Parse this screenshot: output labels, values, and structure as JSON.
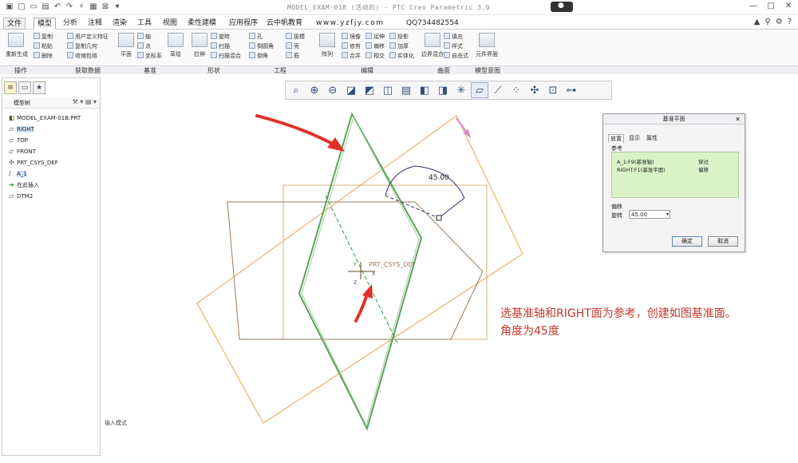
{
  "window": {
    "title": "MODEL_EXAM-01B (活动的) - PTC Creo Parametric 3.0"
  },
  "ribbon": {
    "tabs": [
      "文件",
      "模型",
      "分析",
      "注释",
      "渲染",
      "工具",
      "视图",
      "柔性建模",
      "应用程序",
      "云中帆教育",
      "www.yzfjy.com",
      "QQ734482554"
    ],
    "groups": {
      "operations": "操作",
      "get_data": "获取数据",
      "datum": "基准",
      "shapes": "形状",
      "engineering": "工程",
      "edit": "编辑",
      "surfaces": "曲面",
      "model_intent": "模型意图"
    },
    "items": {
      "regenerate": "重新生成",
      "copy": "复制",
      "paste": "粘贴",
      "delete": "删除",
      "user_defined_feature": "用户定义特征",
      "copy_geometry": "复制几何",
      "shrinkwrap": "收缩包络",
      "plane": "平面",
      "axis": "轴",
      "point": "点",
      "coord_sys": "坐标系",
      "sketch": "草绘",
      "extrude": "拉伸",
      "revolve": "旋转",
      "sweep": "扫描",
      "swept_blend": "扫描混合",
      "hole": "孔",
      "round": "倒圆角",
      "chamfer": "倒角",
      "draft": "拔模",
      "shell": "壳",
      "rib": "筋",
      "pattern": "阵列",
      "mirror": "镜像",
      "trim": "修剪",
      "merge": "合并",
      "extend": "延伸",
      "offset": "偏移",
      "intersect": "相交",
      "project": "投影",
      "thicken": "加厚",
      "solidify": "实体化",
      "boundary_blend": "边界混合",
      "fill": "填充",
      "style": "样式",
      "freestyle": "自由式",
      "component_interface": "元件界面"
    }
  },
  "model_tree": {
    "header": "模型树",
    "items": [
      {
        "label": "MODEL_EXAM-01B.PRT",
        "icon": "part-icon"
      },
      {
        "label": "RIGHT",
        "icon": "datum-plane-icon",
        "selected": true
      },
      {
        "label": "TOP",
        "icon": "datum-plane-icon"
      },
      {
        "label": "FRONT",
        "icon": "datum-plane-icon"
      },
      {
        "label": "PRT_CSYS_DEF",
        "icon": "csys-icon"
      },
      {
        "label": "A_1",
        "icon": "datum-axis-icon"
      },
      {
        "label": "在此插入",
        "icon": "insert-here-icon"
      },
      {
        "label": "DTM2",
        "icon": "datum-plane-icon"
      }
    ]
  },
  "status_bar": {
    "text": "插入模式"
  },
  "graphics": {
    "angle_label": "45.00",
    "csys_label": "PRT_CSYS_DEF"
  },
  "dialog": {
    "title": "基准平面",
    "tabs": [
      "放置",
      "显示",
      "属性"
    ],
    "active_tab": "放置",
    "references_label": "参考",
    "references": [
      {
        "name": "A_1:F9(基准轴)",
        "constraint": "穿过"
      },
      {
        "name": "RIGHT:F1(基准平面)",
        "constraint": "偏移"
      }
    ],
    "offset_label": "偏移",
    "rotation_label": "旋转",
    "rotation_value": "45.00",
    "ok_label": "确定",
    "cancel_label": "取消"
  },
  "annotation": {
    "line1": "选基准轴和RIGHT面为参考，创建如图基准面。",
    "line2": "角度为45度"
  },
  "colors": {
    "accent_blue": "#2d5fa8",
    "arrow_red": "#e0302a",
    "plane_orange": "#e8b26a",
    "plane_brown": "#9b7a5a",
    "plane_green": "#5aa35a",
    "annotation_red": "#c0392b"
  }
}
